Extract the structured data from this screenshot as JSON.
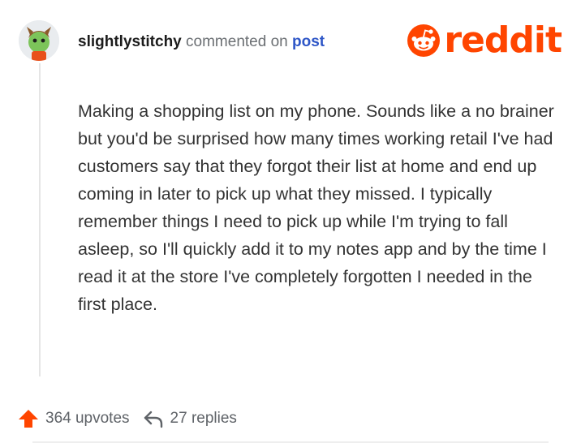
{
  "comment": {
    "username": "slightlystitchy",
    "action_text": "commented on",
    "post_link_label": "post",
    "body": "Making a shopping list on my phone. Sounds like a no brainer but you'd be surprised how many times working retail I've had customers say that they forgot their list at home and end up coming in later to pick up what they missed. I typically remember things I need to pick up while I'm trying to fall asleep, so I'll quickly add it to my notes app and by the time I read it at the store I've completely forgotten I needed in the first place."
  },
  "brand": {
    "name": "reddit",
    "icon": "reddit-snoo-icon",
    "color": "#ff4500"
  },
  "stats": {
    "upvotes_label": "364 upvotes",
    "replies_label": "27 replies",
    "upvote_icon": "upvote-arrow-icon",
    "reply_icon": "reply-arrow-icon"
  },
  "colors": {
    "accent": "#ff4500",
    "link": "#2e56c7",
    "muted": "#6b6f73"
  }
}
